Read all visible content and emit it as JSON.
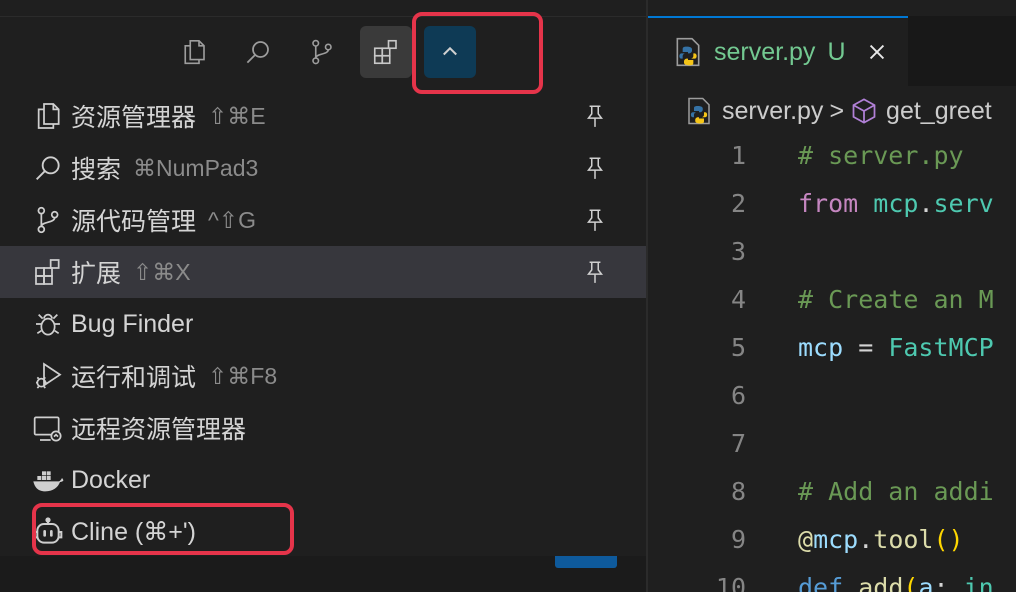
{
  "toolbar": {
    "buttons": [
      {
        "icon": "explorer-files-icon"
      },
      {
        "icon": "search-icon"
      },
      {
        "icon": "source-control-icon"
      },
      {
        "icon": "extensions-icon"
      },
      {
        "icon": "chevron-up-icon"
      }
    ]
  },
  "menu": {
    "items": [
      {
        "label": "资源管理器",
        "shortcut": "⇧⌘E",
        "icon": "explorer-files-icon",
        "pinned": true
      },
      {
        "label": "搜索",
        "shortcut": "⌘NumPad3",
        "icon": "search-icon",
        "pinned": true
      },
      {
        "label": "源代码管理",
        "shortcut": "^⇧G",
        "icon": "source-control-icon",
        "pinned": true
      },
      {
        "label": "扩展",
        "shortcut": "⇧⌘X",
        "icon": "extensions-icon",
        "pinned": true
      },
      {
        "label": "Bug Finder",
        "shortcut": "",
        "icon": "bug-icon",
        "pinned": false
      },
      {
        "label": "运行和调试",
        "shortcut": "⇧⌘F8",
        "icon": "run-debug-icon",
        "pinned": false
      },
      {
        "label": "远程资源管理器",
        "shortcut": "",
        "icon": "remote-explorer-icon",
        "pinned": false
      },
      {
        "label": "Docker",
        "shortcut": "",
        "icon": "docker-icon",
        "pinned": false
      },
      {
        "label": "Cline (⌘+')",
        "shortcut": "",
        "icon": "cline-robot-icon",
        "pinned": false
      }
    ]
  },
  "editor": {
    "tab": {
      "name": "server.py",
      "badge": "U",
      "icon": "python-file-icon"
    },
    "breadcrumb": {
      "file": "server.py",
      "separator": ">",
      "symbol": "get_greet"
    },
    "lines": [
      {
        "n": "1",
        "tokens": [
          {
            "t": "# server.py",
            "c": "comment"
          }
        ]
      },
      {
        "n": "2",
        "tokens": [
          {
            "t": "from",
            "c": "kw"
          },
          {
            "t": " ",
            "c": "plain"
          },
          {
            "t": "mcp",
            "c": "cls"
          },
          {
            "t": ".",
            "c": "plain"
          },
          {
            "t": "serv",
            "c": "cls"
          }
        ]
      },
      {
        "n": "3",
        "tokens": []
      },
      {
        "n": "4",
        "tokens": [
          {
            "t": "# Create an M",
            "c": "comment"
          }
        ]
      },
      {
        "n": "5",
        "tokens": [
          {
            "t": "mcp",
            "c": "id"
          },
          {
            "t": " = ",
            "c": "plain"
          },
          {
            "t": "FastMCP",
            "c": "cls"
          }
        ]
      },
      {
        "n": "6",
        "tokens": []
      },
      {
        "n": "7",
        "tokens": []
      },
      {
        "n": "8",
        "tokens": [
          {
            "t": "# Add an addi",
            "c": "comment"
          }
        ]
      },
      {
        "n": "9",
        "tokens": [
          {
            "t": "@",
            "c": "fn"
          },
          {
            "t": "mcp",
            "c": "id"
          },
          {
            "t": ".",
            "c": "plain"
          },
          {
            "t": "tool",
            "c": "fn"
          },
          {
            "t": "()",
            "c": "paren"
          }
        ]
      },
      {
        "n": "10",
        "tokens": [
          {
            "t": "def",
            "c": "def"
          },
          {
            "t": " ",
            "c": "plain"
          },
          {
            "t": "add",
            "c": "fn"
          },
          {
            "t": "(",
            "c": "paren"
          },
          {
            "t": "a",
            "c": "id"
          },
          {
            "t": ": ",
            "c": "plain"
          },
          {
            "t": "in",
            "c": "cls"
          }
        ]
      }
    ]
  },
  "colors": {
    "accent": "#0078d4",
    "highlight_box": "#e5344a",
    "untracked_file": "#73c991"
  }
}
